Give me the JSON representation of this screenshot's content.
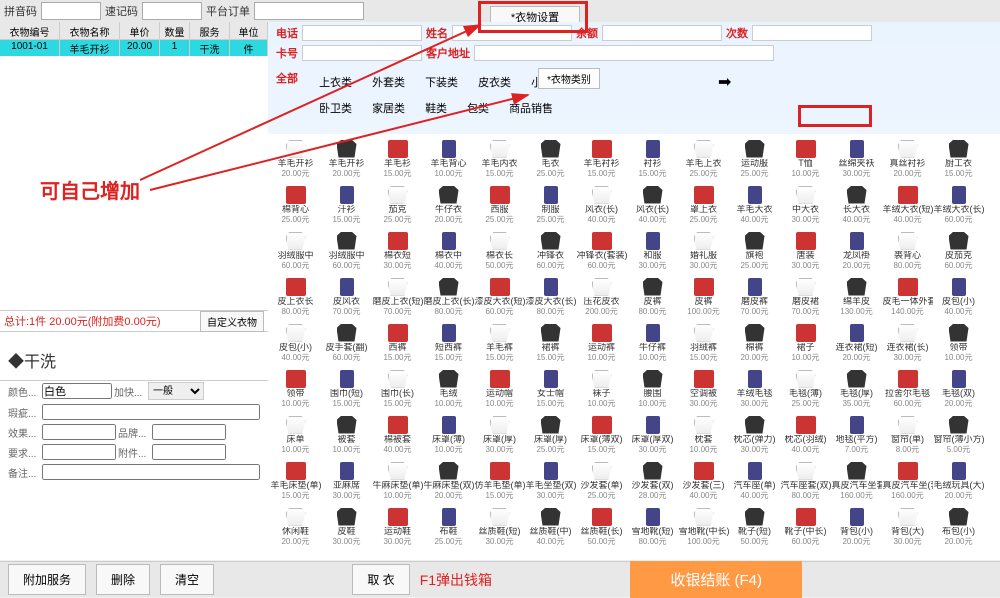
{
  "topbar": {
    "pinyin": "拼音码",
    "suji": "速记码",
    "platform": "平台订单",
    "settings_btn": "*衣物设置"
  },
  "table": {
    "headers": [
      "衣物编号",
      "衣物名称",
      "单价",
      "数量",
      "服务",
      "单位"
    ],
    "row": {
      "id": "1001-01",
      "name": "羊毛开衫",
      "price": "20.00",
      "qty": "1",
      "service": "干洗",
      "unit": "件"
    }
  },
  "annotation": "可自己增加",
  "total": {
    "text": "总计:1件 20.00元(附加费0.00元)",
    "custom_btn": "自定义衣物"
  },
  "wash_type": "◆干洗",
  "form": {
    "color_lbl": "颜色...",
    "color_val": "白色",
    "speed_lbl": "加快...",
    "speed_val": "一般",
    "flaw_lbl": "瑕疵...",
    "effect_lbl": "效果...",
    "brand_lbl": "品牌...",
    "require_lbl": "要求...",
    "attach_lbl": "附件...",
    "remark_lbl": "备注..."
  },
  "customer": {
    "tel_lbl": "电话",
    "name_lbl": "姓名",
    "balance_lbl": "余额",
    "times_lbl": "次数",
    "card_lbl": "卡号",
    "addr_lbl": "客户地址"
  },
  "categories": {
    "all": "全部",
    "row1": [
      "上衣类",
      "外套类",
      "下装类",
      "皮衣类",
      "小件类"
    ],
    "row2": [
      "卧卫类",
      "家居类",
      "鞋类",
      "包类",
      "商品销售"
    ],
    "add_btn": "*衣物类别",
    "arrow": "➡"
  },
  "items": [
    {
      "n": "羊毛开衫",
      "p": "20.00元"
    },
    {
      "n": "羊毛开衫",
      "p": "20.00元"
    },
    {
      "n": "羊毛衫",
      "p": "15.00元"
    },
    {
      "n": "羊毛背心",
      "p": "10.00元"
    },
    {
      "n": "羊毛内衣",
      "p": "15.00元"
    },
    {
      "n": "毛衣",
      "p": "25.00元"
    },
    {
      "n": "羊毛衬衫",
      "p": "15.00元"
    },
    {
      "n": "衬衫",
      "p": "15.00元"
    },
    {
      "n": "羊毛上衣",
      "p": "25.00元"
    },
    {
      "n": "运动服",
      "p": "25.00元"
    },
    {
      "n": "T恤",
      "p": "10.00元"
    },
    {
      "n": "丝绵夹袄",
      "p": "30.00元"
    },
    {
      "n": "真丝衬衫",
      "p": "20.00元"
    },
    {
      "n": "厨工衣",
      "p": "15.00元"
    },
    {
      "n": "棉背心",
      "p": "25.00元"
    },
    {
      "n": "汗衫",
      "p": "15.00元"
    },
    {
      "n": "茄克",
      "p": "25.00元"
    },
    {
      "n": "牛仔衣",
      "p": "20.00元"
    },
    {
      "n": "西服",
      "p": "25.00元"
    },
    {
      "n": "制服",
      "p": "25.00元"
    },
    {
      "n": "风衣(长)",
      "p": "40.00元"
    },
    {
      "n": "风衣(长)",
      "p": "40.00元"
    },
    {
      "n": "罩上衣",
      "p": "25.00元"
    },
    {
      "n": "羊毛大衣",
      "p": "40.00元"
    },
    {
      "n": "中大衣",
      "p": "30.00元"
    },
    {
      "n": "长大衣",
      "p": "40.00元"
    },
    {
      "n": "羊绒大衣(短)",
      "p": "40.00元"
    },
    {
      "n": "羊绒大衣(长)",
      "p": "60.00元"
    },
    {
      "n": "羽绒服中",
      "p": "60.00元"
    },
    {
      "n": "羽绒服中",
      "p": "60.00元"
    },
    {
      "n": "棉衣短",
      "p": "30.00元"
    },
    {
      "n": "棉衣中",
      "p": "40.00元"
    },
    {
      "n": "棉衣长",
      "p": "50.00元"
    },
    {
      "n": "冲锋衣",
      "p": "60.00元"
    },
    {
      "n": "冲锋衣(套装)",
      "p": "60.00元"
    },
    {
      "n": "和服",
      "p": "30.00元"
    },
    {
      "n": "婚礼服",
      "p": "30.00元"
    },
    {
      "n": "旗袍",
      "p": "25.00元"
    },
    {
      "n": "唐装",
      "p": "30.00元"
    },
    {
      "n": "龙凤褂",
      "p": "20.00元"
    },
    {
      "n": "裘背心",
      "p": "80.00元"
    },
    {
      "n": "皮茄克",
      "p": "60.00元"
    },
    {
      "n": "皮上衣长",
      "p": "80.00元"
    },
    {
      "n": "皮风衣",
      "p": "70.00元"
    },
    {
      "n": "磨皮上衣(短)",
      "p": "70.00元"
    },
    {
      "n": "磨皮上衣(长)",
      "p": "80.00元"
    },
    {
      "n": "漆皮大衣(短)",
      "p": "60.00元"
    },
    {
      "n": "漆皮大衣(长)",
      "p": "80.00元"
    },
    {
      "n": "压花皮衣",
      "p": "200.00元"
    },
    {
      "n": "皮裤",
      "p": "80.00元"
    },
    {
      "n": "皮裤",
      "p": "100.00元"
    },
    {
      "n": "磨皮裤",
      "p": "70.00元"
    },
    {
      "n": "磨皮裙",
      "p": "70.00元"
    },
    {
      "n": "绵羊皮",
      "p": "130.00元"
    },
    {
      "n": "皮毛一体外套",
      "p": "140.00元"
    },
    {
      "n": "皮包(小)",
      "p": "40.00元"
    },
    {
      "n": "皮包(小)",
      "p": "40.00元"
    },
    {
      "n": "皮手套(翻)",
      "p": "60.00元"
    },
    {
      "n": "西裤",
      "p": "15.00元"
    },
    {
      "n": "短西裤",
      "p": "15.00元"
    },
    {
      "n": "羊毛裤",
      "p": "15.00元"
    },
    {
      "n": "裙裤",
      "p": "15.00元"
    },
    {
      "n": "运动裤",
      "p": "10.00元"
    },
    {
      "n": "牛仔裤",
      "p": "10.00元"
    },
    {
      "n": "羽绒裤",
      "p": "15.00元"
    },
    {
      "n": "棉裤",
      "p": "20.00元"
    },
    {
      "n": "裙子",
      "p": "10.00元"
    },
    {
      "n": "连衣裙(短)",
      "p": "20.00元"
    },
    {
      "n": "连衣裙(长)",
      "p": "30.00元"
    },
    {
      "n": "领带",
      "p": "10.00元"
    },
    {
      "n": "领带",
      "p": "10.00元"
    },
    {
      "n": "围巾(短)",
      "p": "15.00元"
    },
    {
      "n": "围巾(长)",
      "p": "15.00元"
    },
    {
      "n": "毛绒",
      "p": "10.00元"
    },
    {
      "n": "运动帽",
      "p": "10.00元"
    },
    {
      "n": "女士帽",
      "p": "15.00元"
    },
    {
      "n": "袜子",
      "p": "10.00元"
    },
    {
      "n": "腰围",
      "p": "10.00元"
    },
    {
      "n": "空调被",
      "p": "30.00元"
    },
    {
      "n": "羊绒毛毯",
      "p": "30.00元"
    },
    {
      "n": "毛毯(薄)",
      "p": "25.00元"
    },
    {
      "n": "毛毯(厚)",
      "p": "35.00元"
    },
    {
      "n": "拉舍尔毛毯",
      "p": "60.00元"
    },
    {
      "n": "毛毯(双)",
      "p": "20.00元"
    },
    {
      "n": "床单",
      "p": "10.00元"
    },
    {
      "n": "被套",
      "p": "10.00元"
    },
    {
      "n": "棉被套",
      "p": "40.00元"
    },
    {
      "n": "床罩(薄)",
      "p": "10.00元"
    },
    {
      "n": "床罩(厚)",
      "p": "30.00元"
    },
    {
      "n": "床罩(厚)",
      "p": "25.00元"
    },
    {
      "n": "床罩(薄双)",
      "p": "15.00元"
    },
    {
      "n": "床罩(厚双)",
      "p": "30.00元"
    },
    {
      "n": "枕套",
      "p": "10.00元"
    },
    {
      "n": "枕芯(弹力)",
      "p": "30.00元"
    },
    {
      "n": "枕芯(羽绒)",
      "p": "40.00元"
    },
    {
      "n": "地毯(平方)",
      "p": "7.00元"
    },
    {
      "n": "窗帘(单)",
      "p": "8.00元"
    },
    {
      "n": "窗帘(薄小方)",
      "p": "5.00元"
    },
    {
      "n": "羊毛床垫(单)",
      "p": "15.00元"
    },
    {
      "n": "亚麻席",
      "p": "30.00元"
    },
    {
      "n": "牛麻床垫(单)",
      "p": "10.00元"
    },
    {
      "n": "牛麻床垫(双)",
      "p": "20.00元"
    },
    {
      "n": "仿羊毛垫(单)",
      "p": "15.00元"
    },
    {
      "n": "羊毛坐垫(双)",
      "p": "30.00元"
    },
    {
      "n": "沙发套(单)",
      "p": "25.00元"
    },
    {
      "n": "沙发套(双)",
      "p": "28.00元"
    },
    {
      "n": "沙发套(三)",
      "p": "40.00元"
    },
    {
      "n": "汽车座(单)",
      "p": "40.00元"
    },
    {
      "n": "汽车座套(双)",
      "p": "80.00元"
    },
    {
      "n": "真皮汽车坐套",
      "p": "160.00元"
    },
    {
      "n": "真皮汽车坐(套)",
      "p": "160.00元"
    },
    {
      "n": "毛绒玩具(大)",
      "p": "20.00元"
    },
    {
      "n": "休闲鞋",
      "p": "20.00元"
    },
    {
      "n": "皮鞋",
      "p": "30.00元"
    },
    {
      "n": "运动鞋",
      "p": "30.00元"
    },
    {
      "n": "布鞋",
      "p": "25.00元"
    },
    {
      "n": "丝质鞋(短)",
      "p": "30.00元"
    },
    {
      "n": "丝质鞋(中)",
      "p": "40.00元"
    },
    {
      "n": "丝质鞋(长)",
      "p": "50.00元"
    },
    {
      "n": "雪地靴(短)",
      "p": "80.00元"
    },
    {
      "n": "雪地靴(中长)",
      "p": "100.00元"
    },
    {
      "n": "靴子(短)",
      "p": "50.00元"
    },
    {
      "n": "靴子(中长)",
      "p": "60.00元"
    },
    {
      "n": "背包(小)",
      "p": "20.00元"
    },
    {
      "n": "背包(大)",
      "p": "30.00元"
    },
    {
      "n": "布包(小)",
      "p": "20.00元"
    }
  ],
  "bottom": {
    "addon": "附加服务",
    "delete": "删除",
    "clear": "清空",
    "take": "取 衣",
    "f1": "F1弹出钱箱",
    "checkout": "收银结账 (F4)"
  }
}
